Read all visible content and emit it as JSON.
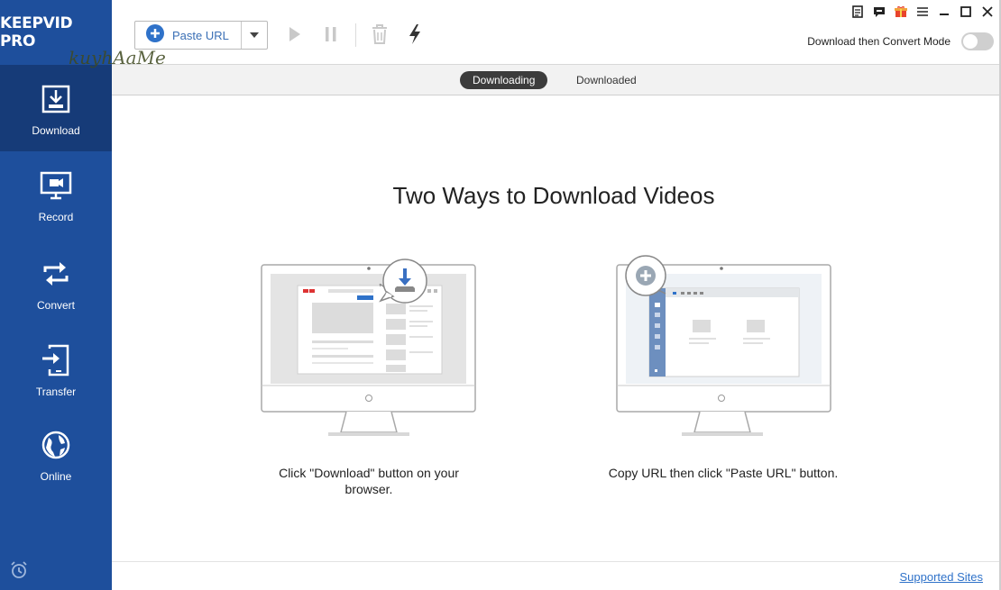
{
  "app": {
    "logo": "KEEPVID PRO"
  },
  "sidebar": {
    "items": [
      {
        "label": "Download",
        "icon": "download-icon",
        "active": true
      },
      {
        "label": "Record",
        "icon": "record-icon"
      },
      {
        "label": "Convert",
        "icon": "convert-icon"
      },
      {
        "label": "Transfer",
        "icon": "transfer-icon"
      },
      {
        "label": "Online",
        "icon": "online-icon"
      }
    ],
    "footer_icon": "alarm-icon"
  },
  "toolbar": {
    "paste_label": "Paste URL",
    "convert_mode_label": "Download then Convert Mode",
    "convert_mode_on": false
  },
  "tabs": [
    {
      "label": "Downloading",
      "active": true
    },
    {
      "label": "Downloaded",
      "active": false
    }
  ],
  "watermark": "kuyhAaMe",
  "main": {
    "title": "Two Ways to Download Videos",
    "way1_caption_line1": "Click \"Download\" button on your",
    "way1_caption_line2": "browser.",
    "way2_caption": "Copy URL then click \"Paste URL\" button."
  },
  "footer": {
    "supported_sites": "Supported Sites"
  },
  "colors": {
    "sidebar": "#1e4f9c",
    "sidebar_active": "#163b78",
    "accent": "#3a6fb5",
    "link": "#2f72c9"
  }
}
